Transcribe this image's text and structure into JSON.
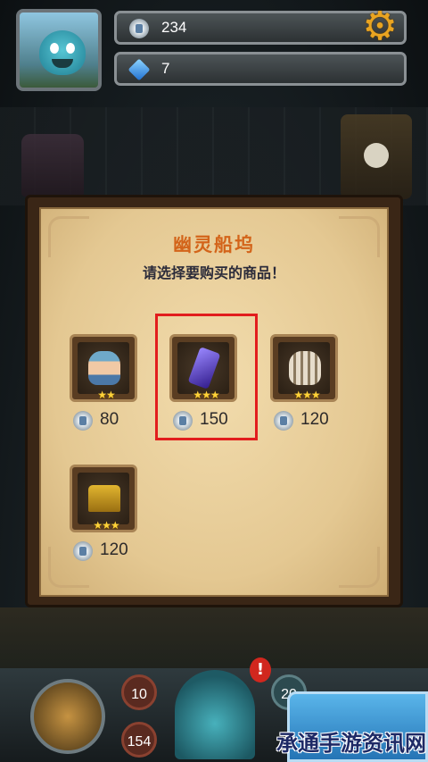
{
  "hud": {
    "silver_count": "234",
    "gem_count": "7",
    "silver_icon": "silver-coin-icon",
    "gem_icon": "blue-gem-icon",
    "settings_icon": "gear-icon"
  },
  "shop": {
    "title": "幽灵船坞",
    "subtitle": "请选择要购买的商品！",
    "items": [
      {
        "name": "sailor-hero",
        "stars": "★★",
        "price": "80"
      },
      {
        "name": "purple-crystal",
        "stars": "★★★",
        "price": "150",
        "highlighted": true
      },
      {
        "name": "bone-pile",
        "stars": "★★★",
        "price": "120"
      },
      {
        "name": "gold-chest",
        "stars": "★★★",
        "price": "120"
      }
    ]
  },
  "bottom": {
    "stat_a": "10",
    "stat_b": "154",
    "stat_c": "20",
    "alert": "!"
  },
  "watermark": "承通手游资讯网",
  "colors": {
    "title": "#d3641a",
    "highlight": "#e21d1d",
    "parchment": "#e4c892"
  }
}
